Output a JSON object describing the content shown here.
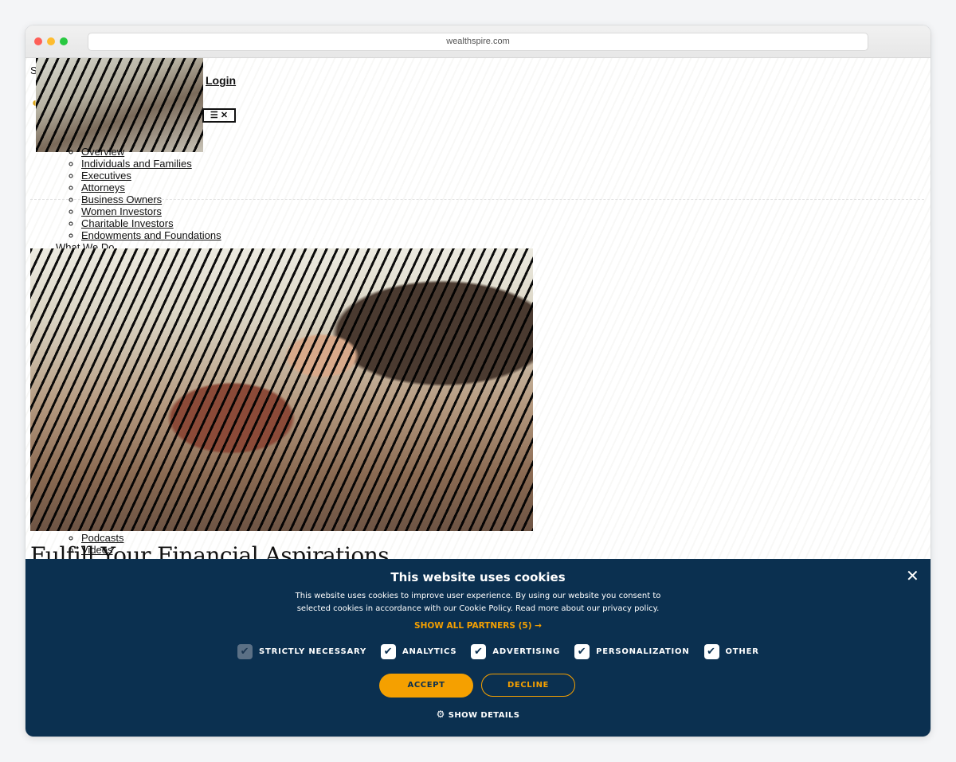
{
  "browser": {
    "url": "wealthspire.com"
  },
  "page": {
    "edge_char": "S",
    "login": "Login",
    "menu_toggle": "☰ ✕",
    "who_we_serve": [
      "Overview",
      "Individuals and Families",
      "Executives",
      "Attorneys",
      "Business Owners",
      "Women Investors",
      "Charitable Investors",
      "Endowments and Foundations"
    ],
    "what_we_do": "What We Do",
    "insights": [
      "Podcasts",
      "Videos"
    ],
    "headline": "Fulfill Your Financial Aspirations"
  },
  "cookie": {
    "title": "This website uses cookies",
    "text": "This website uses cookies to improve user experience. By using our website you consent to selected cookies in accordance with our Cookie Policy. Read more about our privacy policy.",
    "partners_link": "SHOW ALL PARTNERS (5) →",
    "consents": [
      {
        "label": "STRICTLY NECESSARY",
        "checked": true,
        "disabled": true
      },
      {
        "label": "ANALYTICS",
        "checked": true,
        "disabled": false
      },
      {
        "label": "ADVERTISING",
        "checked": true,
        "disabled": false
      },
      {
        "label": "PERSONALIZATION",
        "checked": true,
        "disabled": false
      },
      {
        "label": "OTHER",
        "checked": true,
        "disabled": false
      }
    ],
    "accept": "ACCEPT",
    "decline": "DECLINE",
    "details": "SHOW DETAILS",
    "close": "✕",
    "colors": {
      "background": "#0b3050",
      "accent": "#f5a000"
    }
  }
}
